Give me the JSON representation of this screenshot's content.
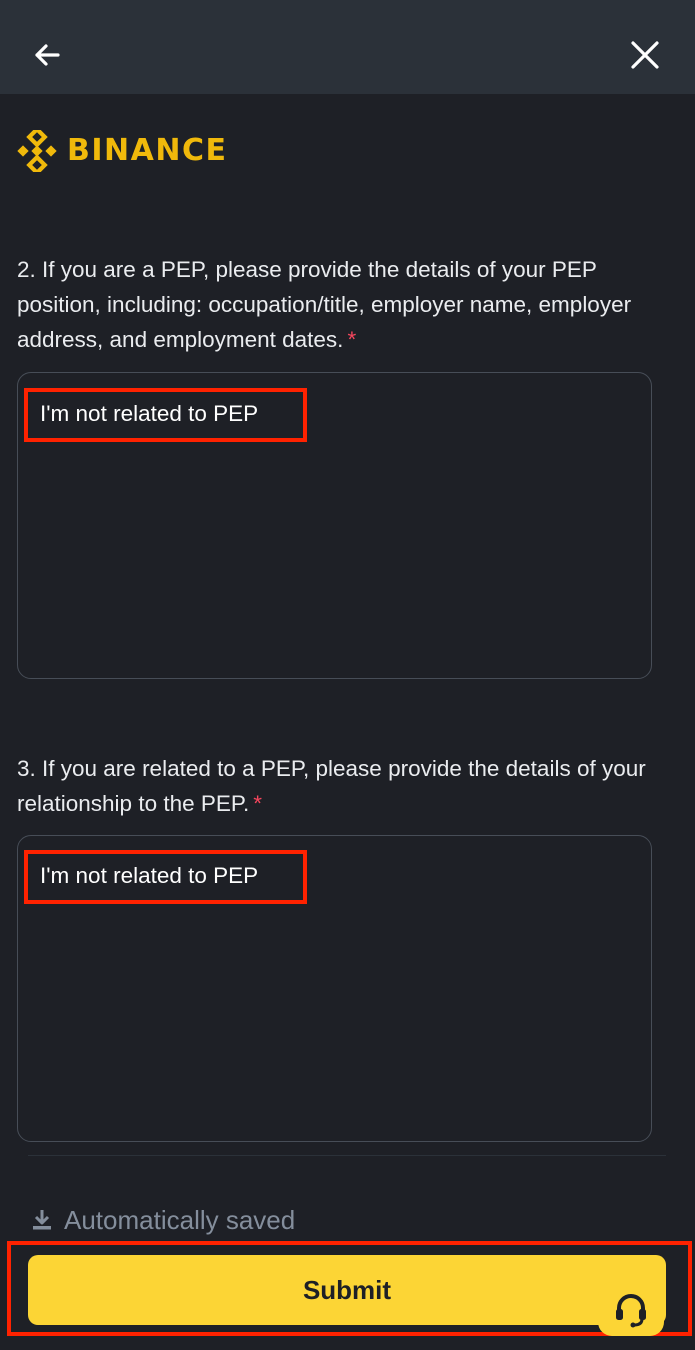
{
  "header": {
    "back_icon": "arrow-left-icon",
    "close_icon": "close-icon"
  },
  "brand": {
    "name": "BINANCE",
    "color": "#F0B90B"
  },
  "form": {
    "question_2": {
      "text": "2. If you are a PEP, please provide the details of your PEP position, including: occupation/title, employer name, employer address, and employment dates.",
      "required_mark": "*",
      "answer": "I'm not related to PEP"
    },
    "question_3": {
      "text": "3. If you are related to a PEP, please provide the details of your relationship to the PEP.",
      "required_mark": "*",
      "answer": "I'm not related to PEP"
    }
  },
  "footer": {
    "autosave_text": "Automatically saved",
    "autosave_icon": "download-icon",
    "submit_label": "Submit",
    "support_icon": "headset-icon"
  },
  "colors": {
    "background": "#1E2026",
    "header_bg": "#2B3139",
    "accent": "#FCD535",
    "required": "#F6465D",
    "highlight": "#FF2200"
  }
}
